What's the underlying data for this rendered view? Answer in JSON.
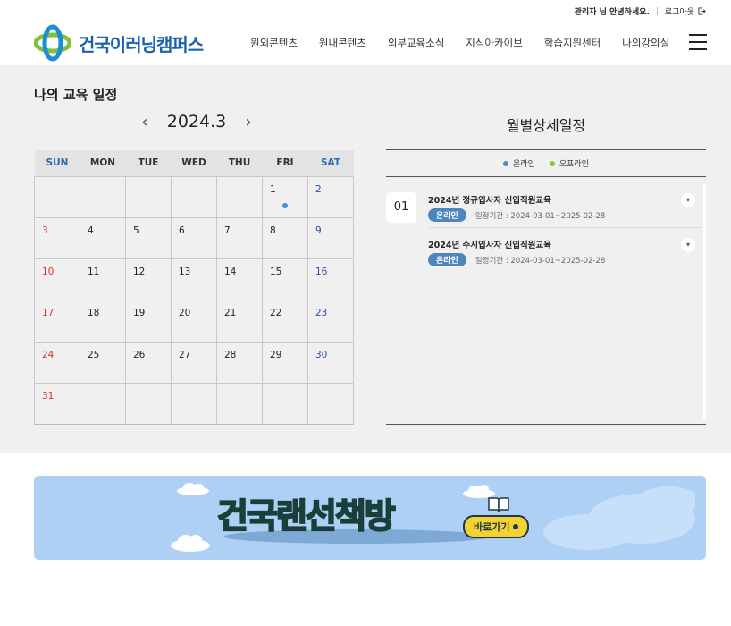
{
  "util": {
    "greeting": "관리자 님 안녕하세요.",
    "logout": "로그아웃"
  },
  "header": {
    "logo_text": "건국이러닝캠퍼스",
    "nav": [
      "원외콘텐츠",
      "원내콘텐츠",
      "외부교육소식",
      "지식아카이브",
      "학습지원센터",
      "나의강의실"
    ]
  },
  "page_title": "나의 교육 일정",
  "calendar": {
    "month_label": "2024.3",
    "prev": "‹",
    "next": "›",
    "weekdays": [
      "SUN",
      "MON",
      "TUE",
      "WED",
      "THU",
      "FRI",
      "SAT"
    ],
    "weeks": [
      [
        "",
        "",
        "",
        "",
        "",
        "1",
        "2"
      ],
      [
        "3",
        "4",
        "5",
        "6",
        "7",
        "8",
        "9"
      ],
      [
        "10",
        "11",
        "12",
        "13",
        "14",
        "15",
        "16"
      ],
      [
        "17",
        "18",
        "19",
        "20",
        "21",
        "22",
        "23"
      ],
      [
        "24",
        "25",
        "26",
        "27",
        "28",
        "29",
        "30"
      ],
      [
        "31",
        "",
        "",
        "",
        "",
        "",
        ""
      ]
    ]
  },
  "detail": {
    "title": "월별상세일정",
    "legend_online": "온라인",
    "legend_offline": "오프라인",
    "day": "01",
    "events": [
      {
        "name": "2024년 정규입사자 신입직원교육",
        "badge": "온라인",
        "period": "일정기간 : 2024-03-01~2025-02-28"
      },
      {
        "name": "2024년 수시입사자 신입직원교육",
        "badge": "온라인",
        "period": "일정기간 : 2024-03-01~2025-02-28"
      }
    ]
  },
  "banner": {
    "title": "건국랜선책방",
    "button": "바로가기"
  },
  "colors": {
    "online": "#4b8fd3",
    "offline": "#8dc63f",
    "brand": "#1b62ad",
    "badge": "#4d86bf"
  }
}
